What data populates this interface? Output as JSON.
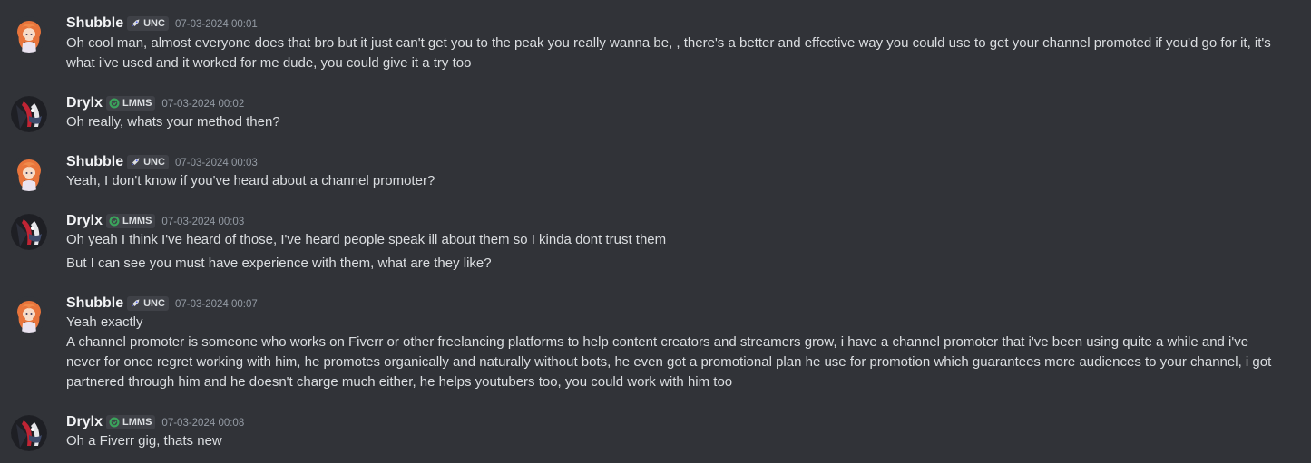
{
  "colors": {
    "background": "#313338",
    "username": "#f2f3f5",
    "message_text": "#dbdee1",
    "timestamp": "#949ba4",
    "tag_background": "#3f4147",
    "lmms_icon": "#3ba55c",
    "unc_icon": "#dbdee1"
  },
  "messages": [
    {
      "author": "Shubble",
      "tag_icon": "rocket-icon",
      "tag": "UNC",
      "timestamp": "07-03-2024 00:01",
      "lines": [
        "Oh cool man, almost everyone does that bro but it just can't get you to the peak you really wanna be, , there's a better and effective way you could use to get your channel promoted if you'd go for it, it's",
        "what i've used and it worked for me dude, you could give it a try too"
      ]
    },
    {
      "author": "Drylx",
      "tag_icon": "lmms-logo-icon",
      "tag": "LMMS",
      "timestamp": "07-03-2024 00:02",
      "lines": [
        "Oh really, whats your method then?"
      ]
    },
    {
      "author": "Shubble",
      "tag_icon": "rocket-icon",
      "tag": "UNC",
      "timestamp": "07-03-2024 00:03",
      "lines": [
        "Yeah, I don't know if you've heard about a channel promoter?"
      ]
    },
    {
      "author": "Drylx",
      "tag_icon": "lmms-logo-icon",
      "tag": "LMMS",
      "timestamp": "07-03-2024 00:03",
      "lines": [
        "Oh yeah I think I've heard of those, I've heard people speak ill about them so I kinda dont trust them",
        "But I can see you must have experience with them, what are they like?"
      ]
    },
    {
      "author": "Shubble",
      "tag_icon": "rocket-icon",
      "tag": "UNC",
      "timestamp": "07-03-2024 00:07",
      "lines": [
        "Yeah exactly",
        "A channel promoter is someone who works on Fiverr or other freelancing platforms to help content creators and streamers grow, i have a channel promoter that i've been  using quite a while and i've",
        "never for once regret working with him, he promotes organically and naturally without bots, he even got a promotional plan he use for promotion which guarantees more audiences to your channel, i got",
        "partnered through him and he doesn't charge much either, he helps youtubers too, you could work with him too"
      ]
    },
    {
      "author": "Drylx",
      "tag_icon": "lmms-logo-icon",
      "tag": "LMMS",
      "timestamp": "07-03-2024 00:08",
      "lines": [
        "Oh a Fiverr gig, thats new"
      ]
    }
  ]
}
